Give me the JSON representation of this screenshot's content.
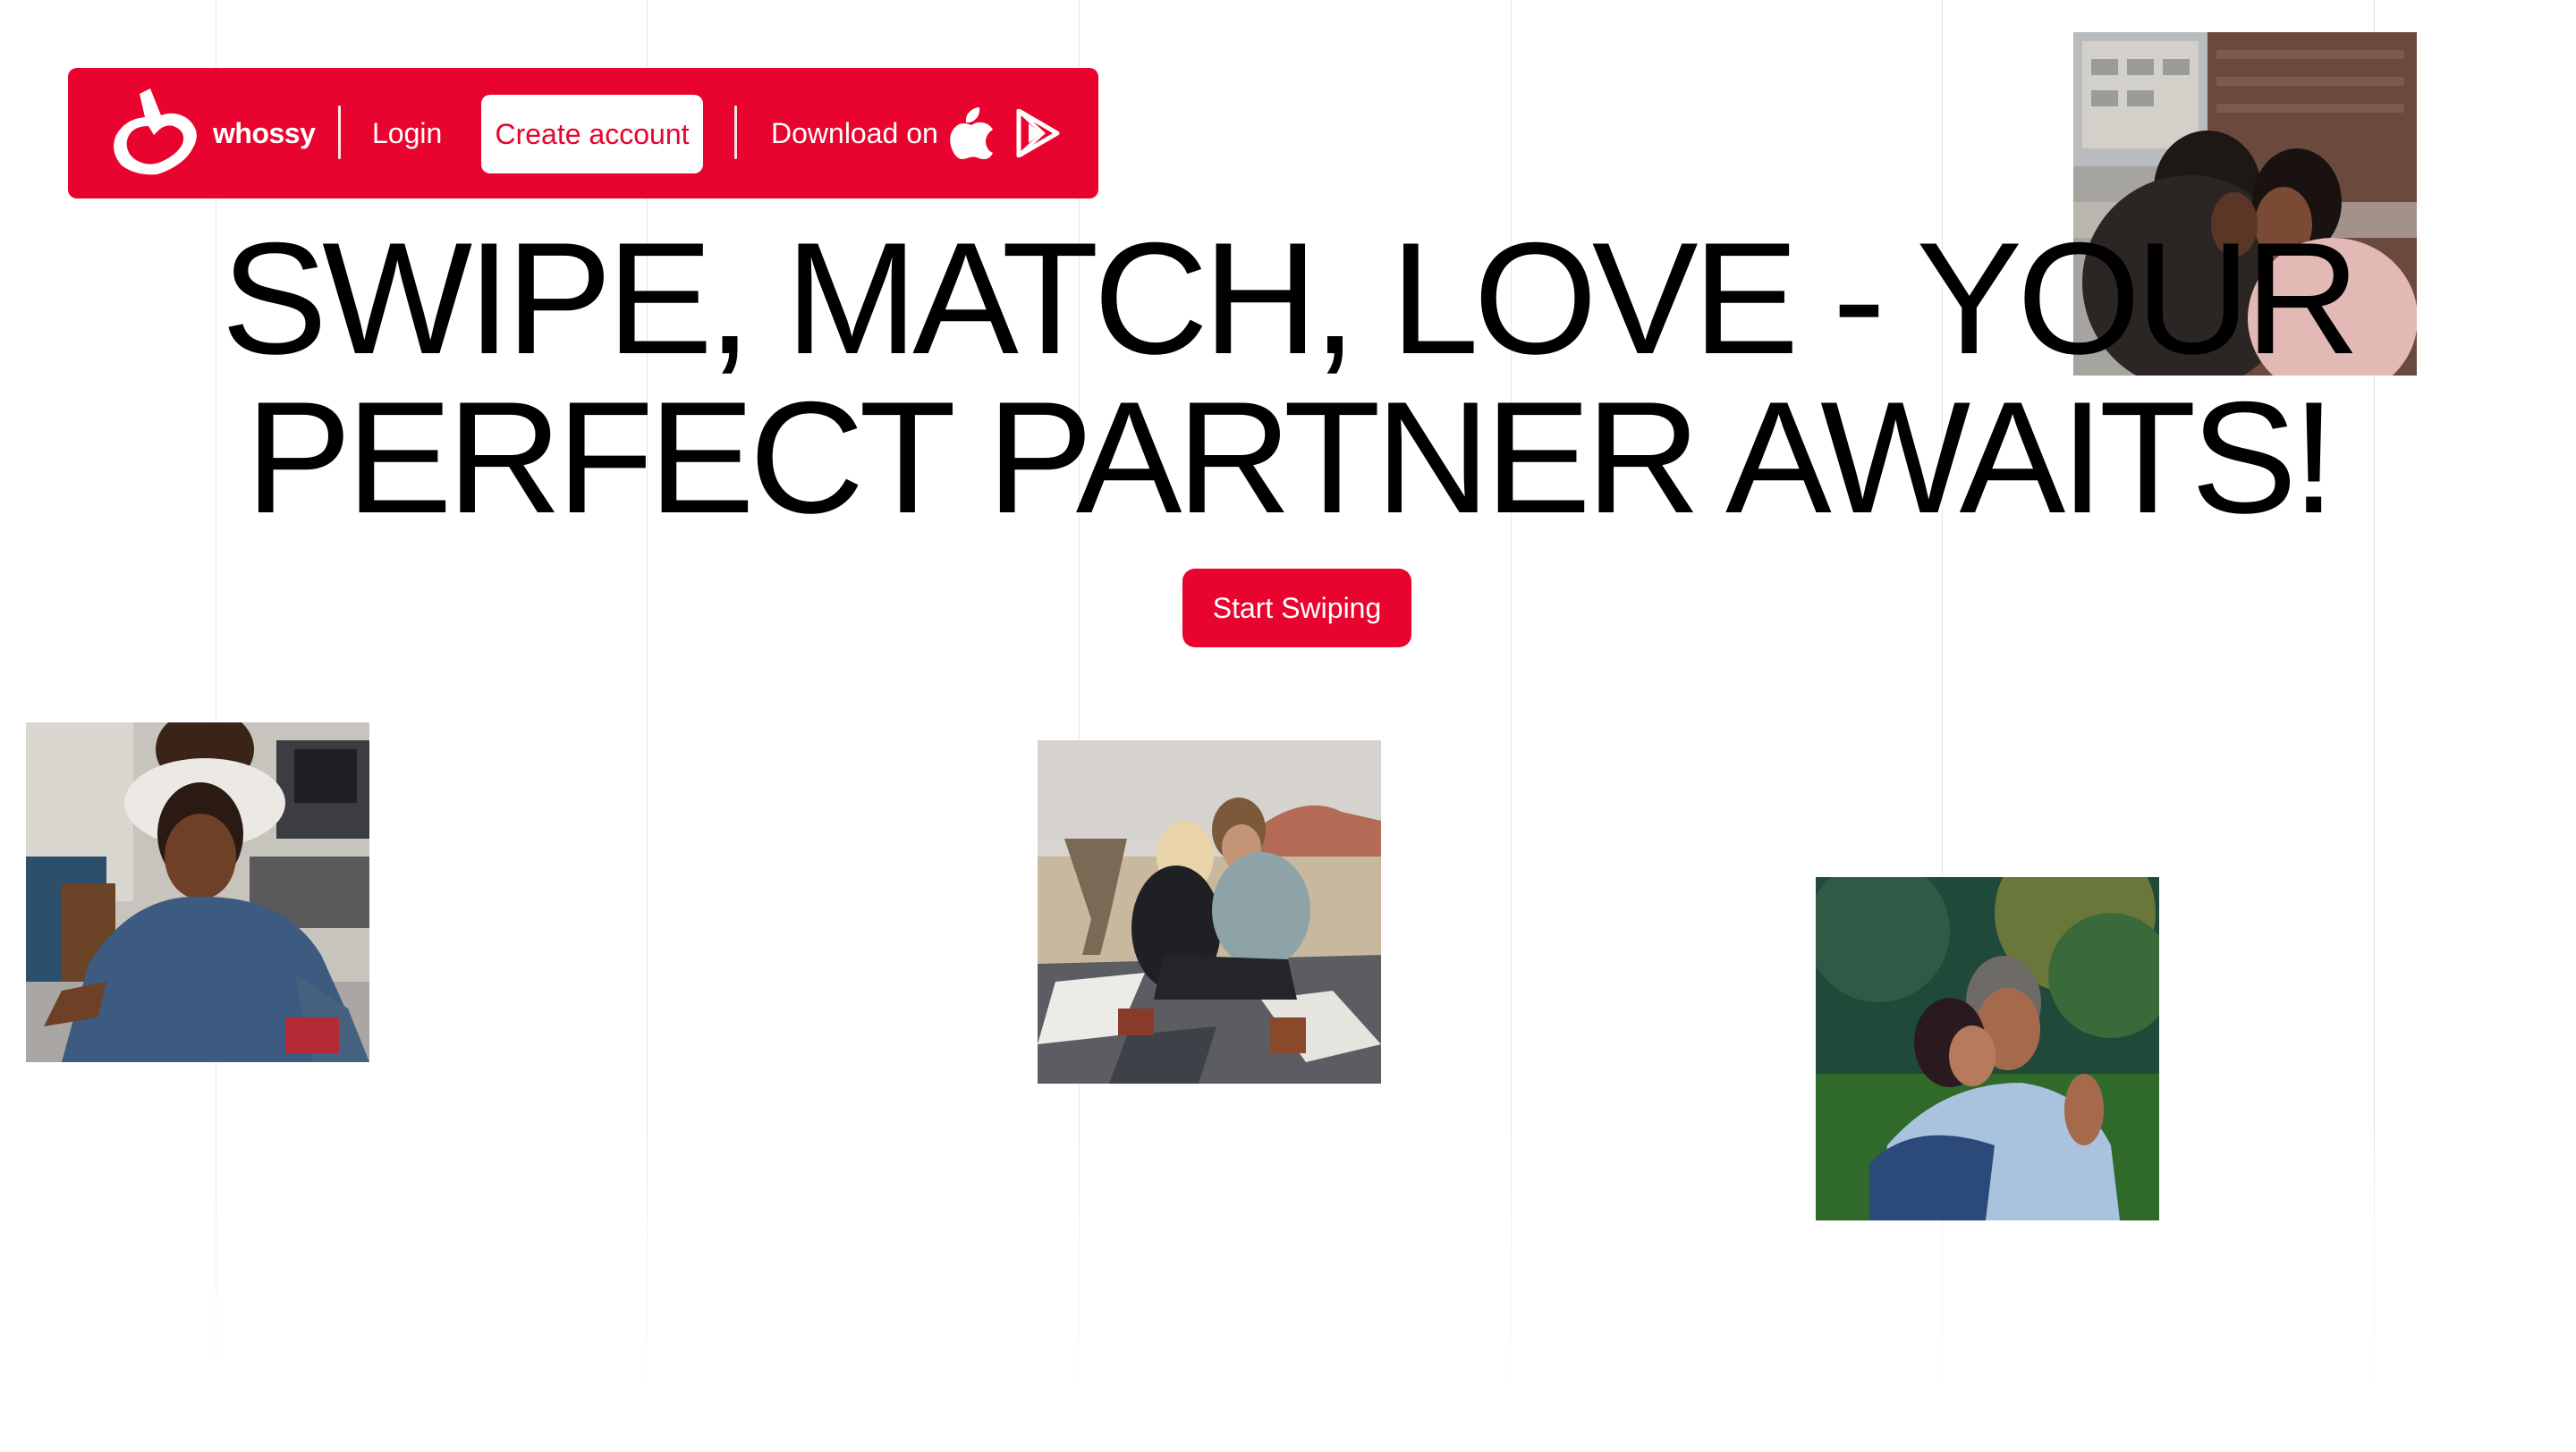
{
  "nav": {
    "brand": "whossy",
    "login_label": "Login",
    "create_account_label": "Create account",
    "download_label": "Download on",
    "logo_icon": "heart-swipe-logo-icon",
    "app_store_icon": "apple-icon",
    "play_store_icon": "google-play-icon"
  },
  "hero": {
    "headline_line1": "SWIPE, MATCH, LOVE - YOUR",
    "headline_line2": "PERFECT PARTNER AWAITS!",
    "cta_label": "Start Swiping"
  },
  "colors": {
    "brand_red": "#e8042e",
    "text": "#000000",
    "background": "#ffffff"
  }
}
